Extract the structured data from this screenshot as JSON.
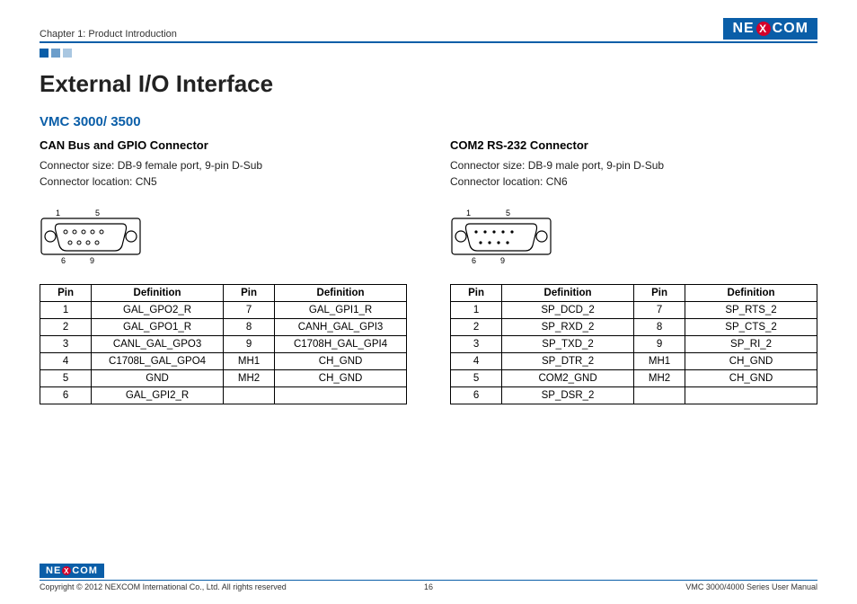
{
  "header": {
    "chapter": "Chapter 1: Product Introduction",
    "logo_a": "NE",
    "logo_x": "X",
    "logo_b": "COM"
  },
  "title": "External I/O Interface",
  "subtitle": "VMC 3000/ 3500",
  "left": {
    "heading": "CAN Bus and GPIO Connector",
    "line1": "Connector size: DB-9 female port, 9-pin D-Sub",
    "line2": "Connector location: CN5",
    "diagram": {
      "tl": "1",
      "tr": "5",
      "bl": "6",
      "br": "9"
    },
    "table": {
      "h1": "Pin",
      "h2": "Definition",
      "h3": "Pin",
      "h4": "Definition",
      "rows": [
        {
          "p1": "1",
          "d1": "GAL_GPO2_R",
          "p2": "7",
          "d2": "GAL_GPI1_R"
        },
        {
          "p1": "2",
          "d1": "GAL_GPO1_R",
          "p2": "8",
          "d2": "CANH_GAL_GPI3"
        },
        {
          "p1": "3",
          "d1": "CANL_GAL_GPO3",
          "p2": "9",
          "d2": "C1708H_GAL_GPI4"
        },
        {
          "p1": "4",
          "d1": "C1708L_GAL_GPO4",
          "p2": "MH1",
          "d2": "CH_GND"
        },
        {
          "p1": "5",
          "d1": "GND",
          "p2": "MH2",
          "d2": "CH_GND"
        },
        {
          "p1": "6",
          "d1": "GAL_GPI2_R",
          "p2": "",
          "d2": ""
        }
      ]
    }
  },
  "right": {
    "heading": "COM2 RS-232 Connector",
    "line1": "Connector size: DB-9 male port, 9-pin D-Sub",
    "line2": "Connector location: CN6",
    "diagram": {
      "tl": "1",
      "tr": "5",
      "bl": "6",
      "br": "9"
    },
    "table": {
      "h1": "Pin",
      "h2": "Definition",
      "h3": "Pin",
      "h4": "Definition",
      "rows": [
        {
          "p1": "1",
          "d1": "SP_DCD_2",
          "p2": "7",
          "d2": "SP_RTS_2"
        },
        {
          "p1": "2",
          "d1": "SP_RXD_2",
          "p2": "8",
          "d2": "SP_CTS_2"
        },
        {
          "p1": "3",
          "d1": "SP_TXD_2",
          "p2": "9",
          "d2": "SP_RI_2"
        },
        {
          "p1": "4",
          "d1": "SP_DTR_2",
          "p2": "MH1",
          "d2": "CH_GND"
        },
        {
          "p1": "5",
          "d1": "COM2_GND",
          "p2": "MH2",
          "d2": "CH_GND"
        },
        {
          "p1": "6",
          "d1": "SP_DSR_2",
          "p2": "",
          "d2": ""
        }
      ]
    }
  },
  "footer": {
    "copyright": "Copyright © 2012 NEXCOM International Co., Ltd. All rights reserved",
    "page": "16",
    "manual": "VMC 3000/4000 Series User Manual"
  }
}
